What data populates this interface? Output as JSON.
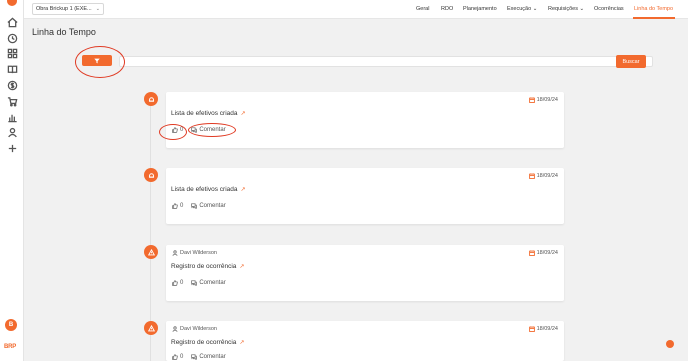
{
  "header": {
    "project_select": "Obra Brickup 1 (EXE...",
    "nav": [
      "Geral",
      "RDO",
      "Planejamento",
      "Execução",
      "Requisições",
      "Ocorrências",
      "Linha do Tempo"
    ],
    "active_nav": "Linha do Tempo"
  },
  "page": {
    "title": "Linha do Tempo",
    "search_button": "Buscar",
    "search_placeholder": ""
  },
  "sidebar": {
    "icons": [
      "home-icon",
      "clock-icon",
      "grid-icon",
      "book-icon",
      "dollar-icon",
      "cart-icon",
      "bar-chart-icon",
      "user-icon",
      "plus-icon"
    ],
    "avatar_initial": "B",
    "brand": "BRP"
  },
  "timeline": [
    {
      "kind": "efetivos",
      "author": "",
      "date": "18/09/24",
      "title": "Lista de efetivos criada",
      "likes": "0",
      "comment_label": "Comentar"
    },
    {
      "kind": "efetivos",
      "author": "",
      "date": "18/09/24",
      "title": "Lista de efetivos criada",
      "likes": "0",
      "comment_label": "Comentar"
    },
    {
      "kind": "ocorrencia",
      "author": "Davi Wilderson",
      "date": "18/09/24",
      "title": "Registro de ocorrência",
      "likes": "0",
      "comment_label": "Comentar"
    },
    {
      "kind": "ocorrencia",
      "author": "Davi Wilderson",
      "date": "18/09/24",
      "title": "Registro de ocorrência",
      "likes": "0",
      "comment_label": "Comentar"
    }
  ],
  "colors": {
    "accent": "#f26a2e",
    "annotation": "#e03b24",
    "background": "#f1f1f1"
  }
}
